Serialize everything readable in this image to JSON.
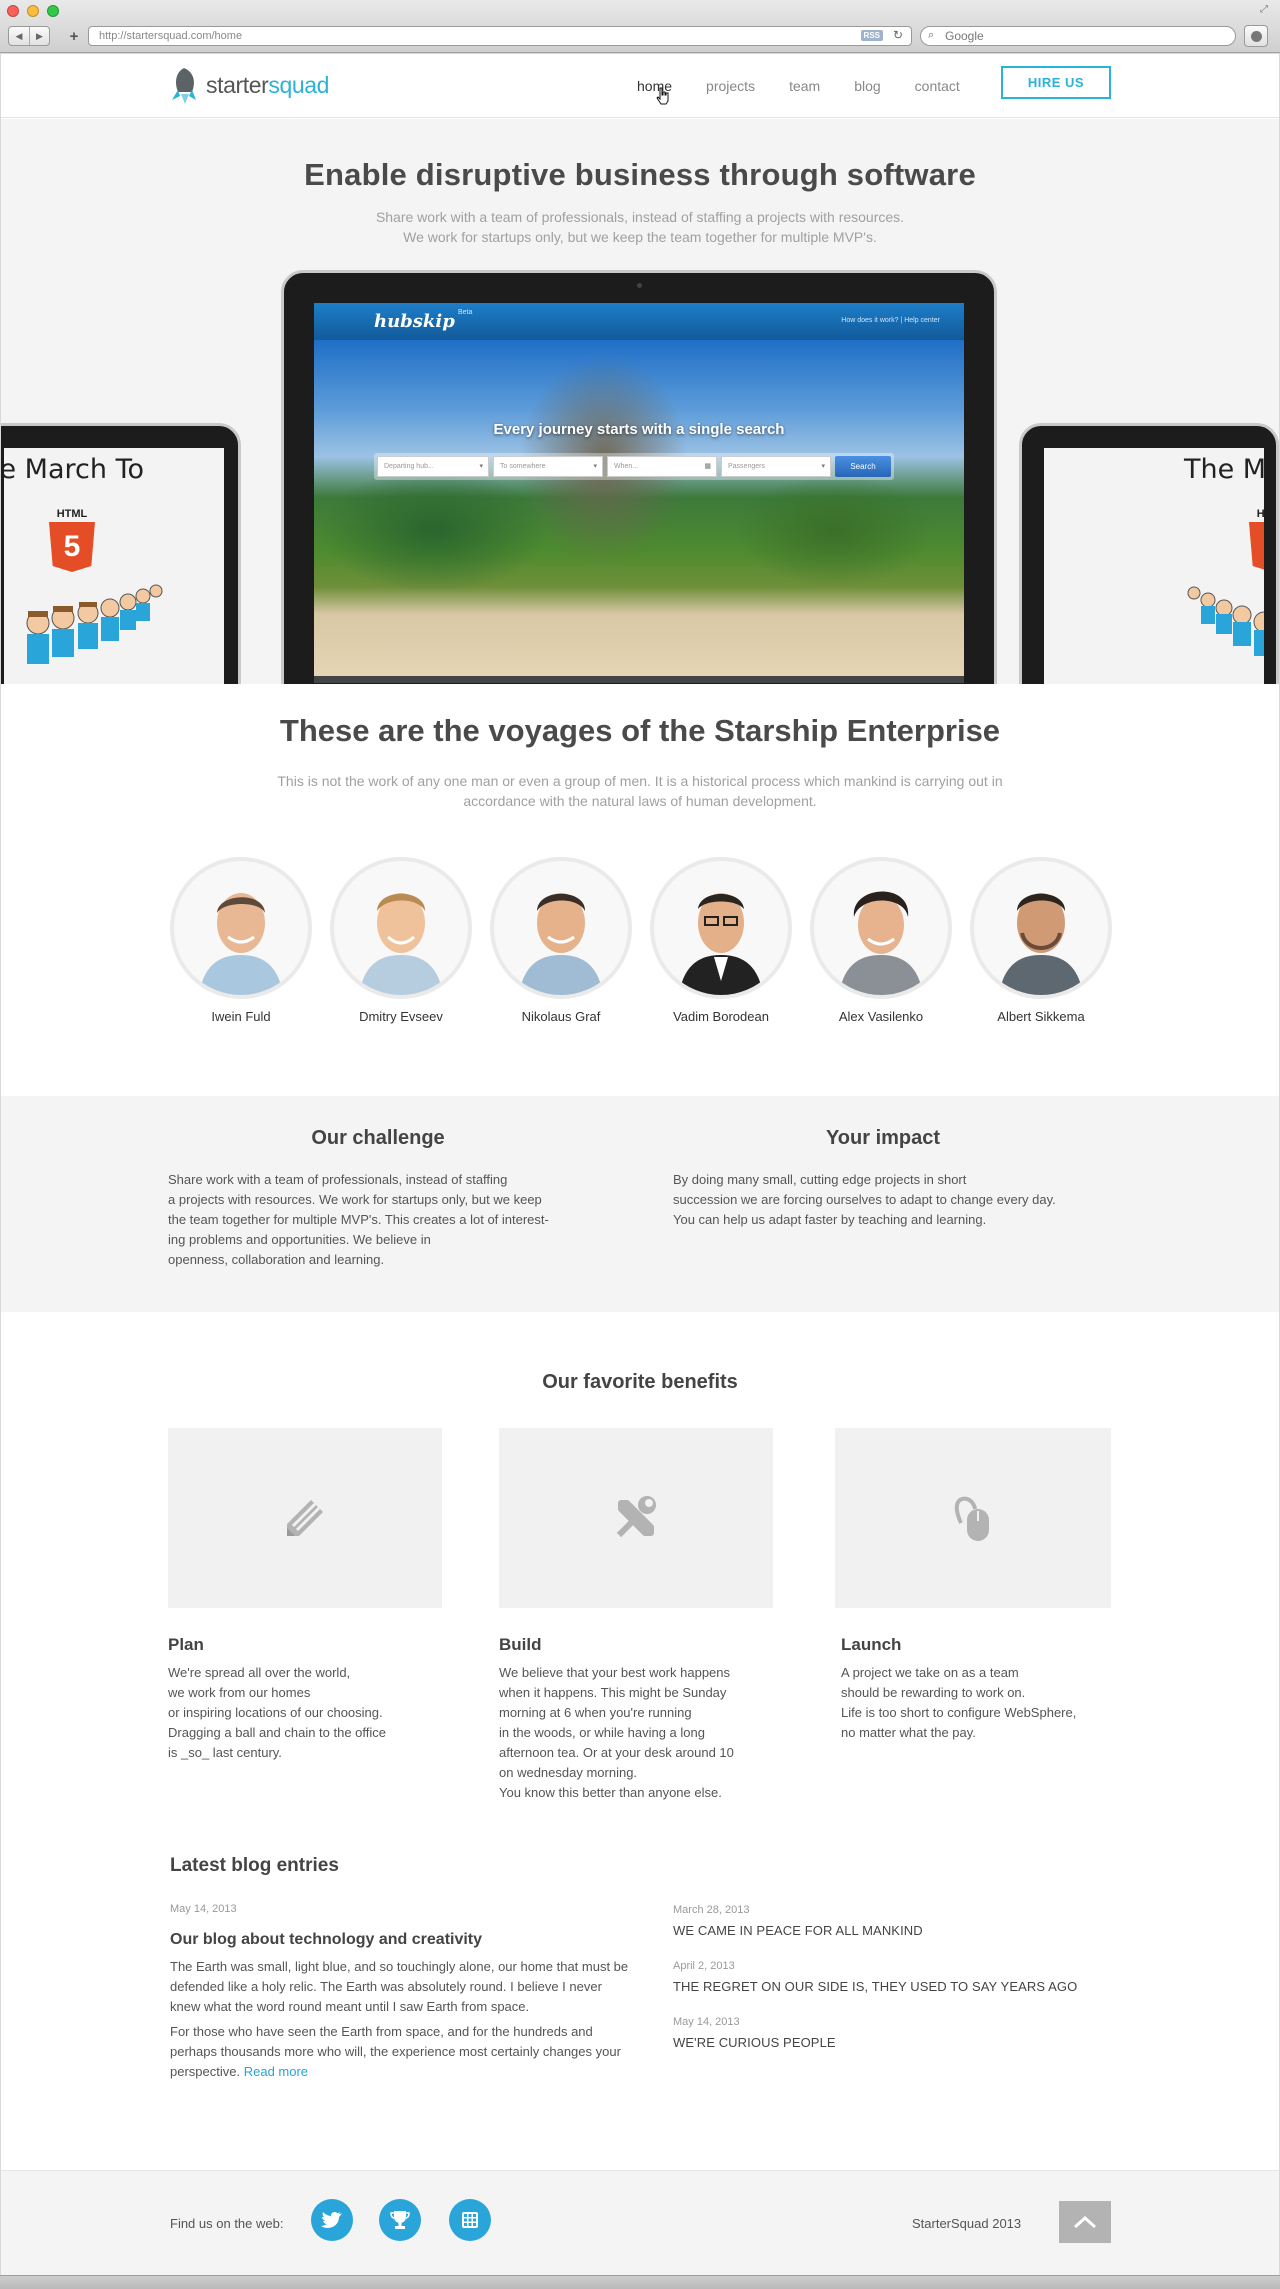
{
  "browser": {
    "url": "http://startersquad.com/home",
    "rss_label": "RSS",
    "search_placeholder": "Google"
  },
  "header": {
    "logo_part1": "starter",
    "logo_part2": "squad",
    "nav": [
      "home",
      "projects",
      "team",
      "blog",
      "contact"
    ],
    "hire_label": "HIRE US"
  },
  "hero": {
    "title": "Enable disruptive business through software",
    "subtitle_line1": "Share work with a team of professionals, instead of staffing a projects with resources.",
    "subtitle_line2": "We work for startups only, but we keep the team together for multiple MVP's.",
    "showcase": {
      "logo": "hubskip",
      "beta": "Beta",
      "links": "How does it work? | Help center",
      "caption": "Every journey starts with a single search",
      "fields": [
        "Departing hub...",
        "To somewhere",
        "When...",
        "Passengers"
      ],
      "button": "Search"
    },
    "left_screen_title": "e March To",
    "right_screen_title": "The Ma",
    "html5_label": "HTML",
    "html5_number": "5"
  },
  "team": {
    "title": "These are the voyages of the Starship Enterprise",
    "subtitle_line1": "This is not the work of any one man or even a group of men. It is a historical process which mankind is carrying out in",
    "subtitle_line2": "accordance with the natural laws of human development.",
    "members": [
      {
        "name": "Iwein Fuld"
      },
      {
        "name": "Dmitry Evseev"
      },
      {
        "name": "Nikolaus Graf"
      },
      {
        "name": "Vadim Borodean"
      },
      {
        "name": "Alex Vasilenko"
      },
      {
        "name": "Albert Sikkema"
      }
    ]
  },
  "challenge": {
    "title": "Our challenge",
    "text": "Share work with a team of professionals, instead of staffing\na projects with resources. We work for startups only, but we keep\nthe team together for multiple MVP's. This creates a lot of interest-\ning problems and opportunities. We believe in\nopenness, collaboration and learning."
  },
  "impact": {
    "title": "Your impact",
    "text": "By doing many small, cutting edge projects in short\nsuccession we are forcing ourselves to adapt to change every day.\nYou can help us adapt faster by teaching and learning."
  },
  "benefits": {
    "title": "Our favorite benefits",
    "items": [
      {
        "title": "Plan",
        "icon": "pencil-icon",
        "text": "We're spread all over the world,\nwe work from our homes\nor inspiring locations of our choosing.\nDragging a ball and chain to the office\n is _so_ last century."
      },
      {
        "title": "Build",
        "icon": "tools-icon",
        "text": "We believe that your best work happens\nwhen it happens. This might be Sunday\nmorning at 6 when you're running\nin the woods, or while having a long\nafternoon tea. Or at your desk around 10\non wednesday morning.\nYou know this better than anyone else."
      },
      {
        "title": "Launch",
        "icon": "mouse-icon",
        "text": "A project we take on as a team\nshould be rewarding to work on.\nLife is too short to configure WebSphere,\nno matter what the pay."
      }
    ]
  },
  "blog": {
    "title": "Latest blog entries",
    "main": {
      "date": "May 14, 2013",
      "title": "Our blog about technology and creativity",
      "p1": "The Earth was small, light blue, and so touchingly alone, our home that must be defended like a holy relic. The Earth was absolutely round. I believe I never knew what the word round meant until I saw Earth from space.",
      "p2": "For those who have seen the Earth from space, and for the hundreds and perhaps thousands more who will, the experience most certainly changes your perspective.",
      "read_more": "Read more"
    },
    "entries": [
      {
        "date": "March 28, 2013",
        "title": "We came in peace for all mankind"
      },
      {
        "date": "April 2, 2013",
        "title": "The regret on our side is, they used to say years ago"
      },
      {
        "date": "May 14, 2013",
        "title": "We're curious people"
      }
    ]
  },
  "footer": {
    "find_us": "Find us on the web:",
    "copyright": "StarterSquad 2013",
    "accent_color": "#2aa5d9"
  }
}
